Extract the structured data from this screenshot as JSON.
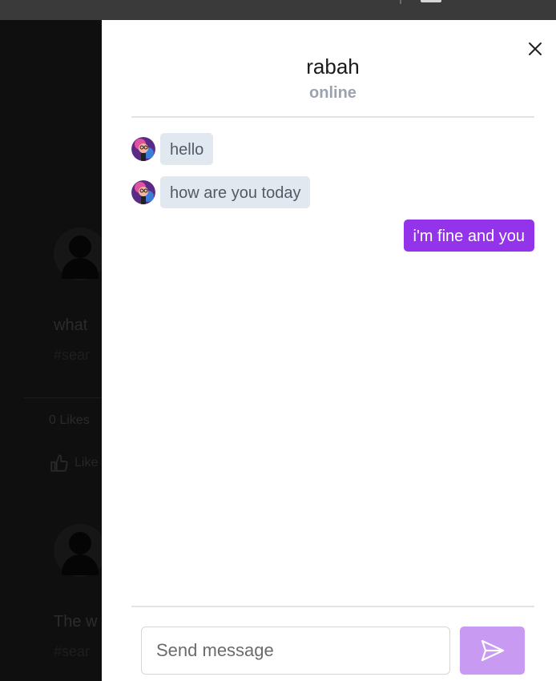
{
  "background_page": {
    "posts": [
      {
        "text": "what",
        "tag": "#sear",
        "likes": "0 Likes",
        "like_label": "Like"
      },
      {
        "text": "The w",
        "tag": "#sear"
      }
    ]
  },
  "chat": {
    "contact_name": "rabah",
    "contact_status": "online",
    "messages": [
      {
        "direction": "incoming",
        "text": "hello"
      },
      {
        "direction": "incoming",
        "text": "how are you today"
      },
      {
        "direction": "outgoing",
        "text": "i'm fine and you"
      }
    ],
    "input": {
      "value": "",
      "placeholder": "Send message"
    }
  },
  "colors": {
    "incoming_bubble": "#e2e8f0",
    "outgoing_bubble": "#9333ea",
    "send_button": "#c99af2",
    "status_text": "#9ca3af"
  },
  "icons": {
    "close": "close-icon",
    "send": "send-icon",
    "avatar": "avatar-icon"
  }
}
